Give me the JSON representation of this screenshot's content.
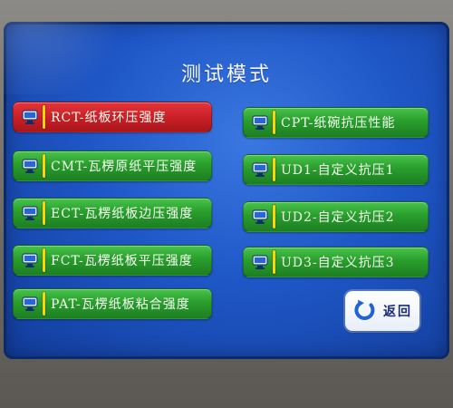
{
  "screen": {
    "title": "测试模式",
    "back_label": "返回"
  },
  "buttons_left": [
    {
      "id": "rct",
      "label": "RCT-纸板环压强度",
      "selected": true
    },
    {
      "id": "cmt",
      "label": "CMT-瓦楞原纸平压强度",
      "selected": false
    },
    {
      "id": "ect",
      "label": "ECT-瓦楞纸板边压强度",
      "selected": false
    },
    {
      "id": "fct",
      "label": "FCT-瓦楞纸板平压强度",
      "selected": false
    },
    {
      "id": "pat",
      "label": "PAT-瓦楞纸板粘合强度",
      "selected": false
    }
  ],
  "buttons_right": [
    {
      "id": "cpt",
      "label": "CPT-纸碗抗压性能",
      "selected": false
    },
    {
      "id": "ud1",
      "label": "UD1-自定义抗压1",
      "selected": false
    },
    {
      "id": "ud2",
      "label": "UD2-自定义抗压2",
      "selected": false
    },
    {
      "id": "ud3",
      "label": "UD3-自定义抗压3",
      "selected": false
    }
  ],
  "icons": {
    "item_icon": "computer-icon",
    "back_icon": "return-arrow-icon"
  },
  "colors": {
    "screen_blue": "#1f57c7",
    "button_green": "#2a9e2c",
    "button_selected_red": "#c81f26",
    "separator_yellow": "#ffd400",
    "back_button_bg": "#ffffff",
    "back_arrow": "#1f63d6"
  }
}
